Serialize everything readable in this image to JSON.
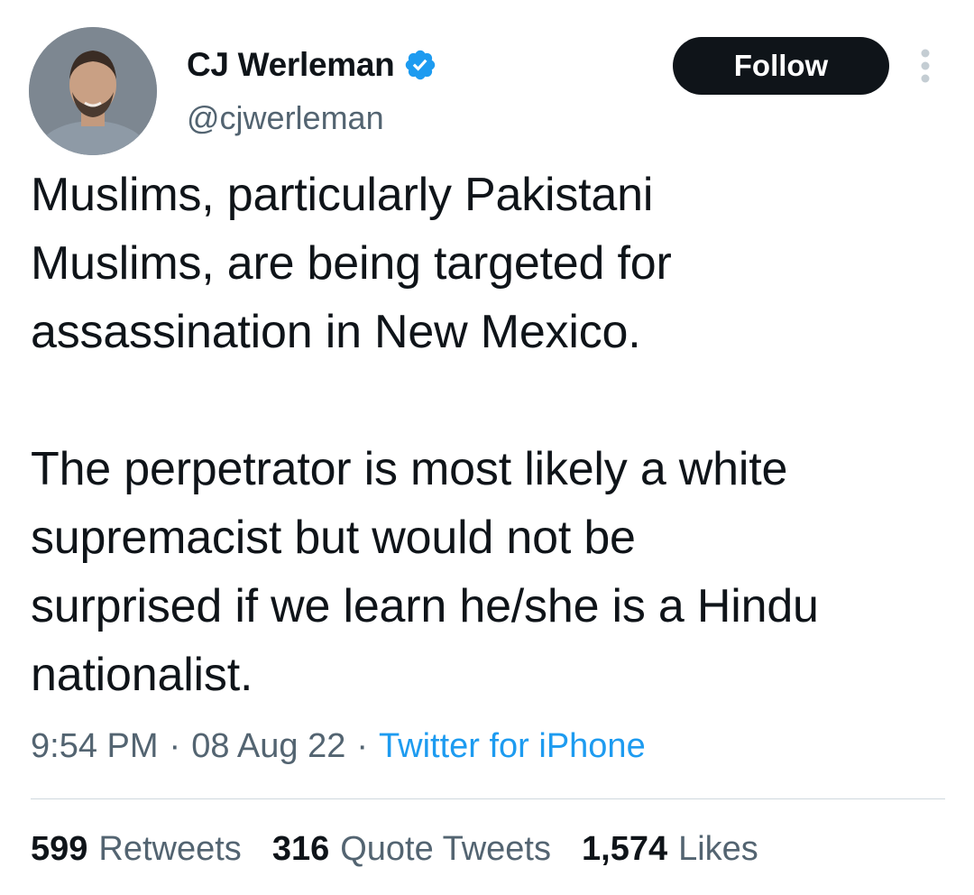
{
  "author": {
    "display_name": "CJ Werleman",
    "handle": "@cjwerleman",
    "verified": true,
    "verified_color": "#1d9bf0"
  },
  "actions": {
    "follow_label": "Follow"
  },
  "tweet": {
    "paragraph1": [
      "Muslims, particularly Pakistani",
      "Muslims, are being targeted for",
      "assassination in New Mexico."
    ],
    "paragraph2": [
      "The perpetrator is most likely a white",
      "supremacist but would not be",
      "surprised if we learn he/she is a Hindu",
      "nationalist."
    ]
  },
  "meta": {
    "time": "9:54 PM",
    "separator": "·",
    "date": "08 Aug 22",
    "source": "Twitter for iPhone"
  },
  "stats": {
    "retweets_count": "599",
    "retweets_label": "Retweets",
    "quotes_count": "316",
    "quotes_label": "Quote Tweets",
    "likes_count": "1,574",
    "likes_label": "Likes"
  },
  "icons": {
    "avatar": "profile-photo",
    "verified": "verified-badge-icon",
    "more": "more-options-icon"
  }
}
